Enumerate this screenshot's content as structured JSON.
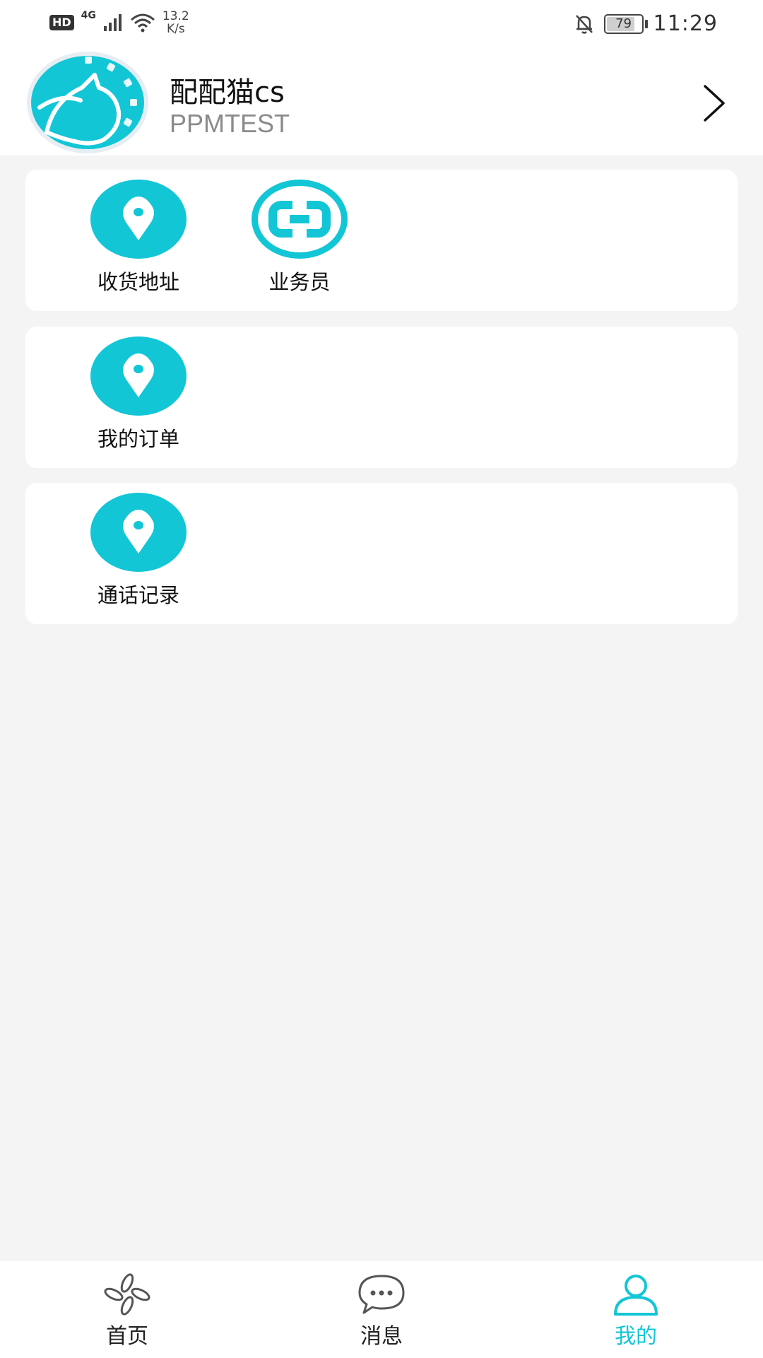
{
  "status_bar": {
    "network_badge": "HD",
    "network_type": "4G",
    "speed_value": "13.2",
    "speed_unit": "K/s",
    "battery": "79",
    "time": "11:29"
  },
  "profile": {
    "name": "配配猫cs",
    "account": "PPMTEST"
  },
  "cards": [
    {
      "items": [
        {
          "label": "收货地址",
          "icon": "location-pin-icon"
        },
        {
          "label": "业务员",
          "icon": "link-icon"
        }
      ]
    },
    {
      "items": [
        {
          "label": "我的订单",
          "icon": "location-pin-icon"
        }
      ]
    },
    {
      "items": [
        {
          "label": "通话记录",
          "icon": "location-pin-icon"
        }
      ]
    }
  ],
  "bottom_nav": {
    "items": [
      {
        "label": "首页",
        "icon": "home-leaves-icon"
      },
      {
        "label": "消息",
        "icon": "chat-bubble-icon"
      },
      {
        "label": "我的",
        "icon": "user-icon"
      }
    ],
    "active_index": 2
  },
  "colors": {
    "accent": "#12c6d6",
    "page_background": "#f4f4f4",
    "card_background": "#ffffff"
  }
}
